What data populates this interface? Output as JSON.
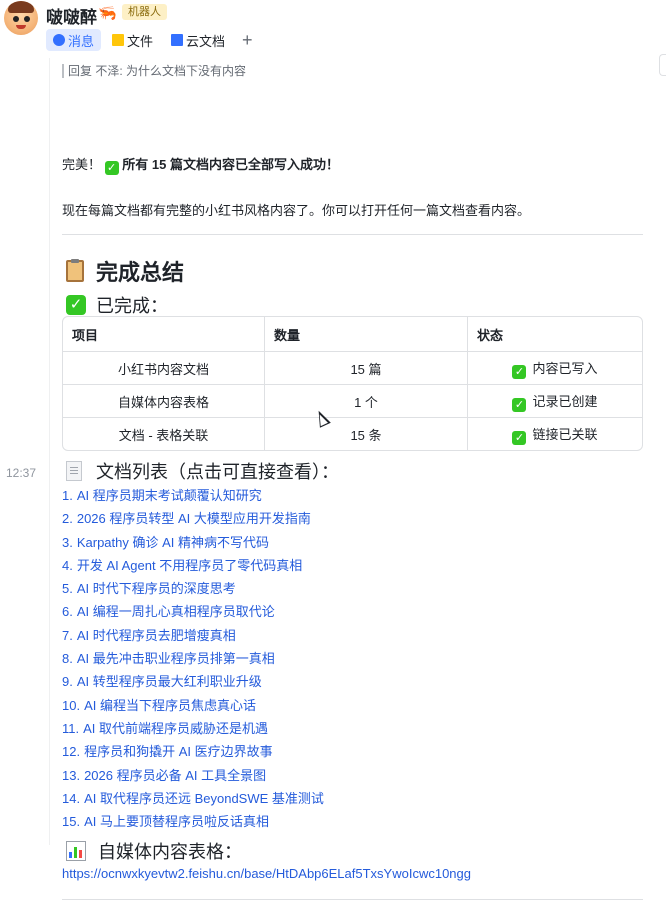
{
  "header": {
    "name": "啵啵醉",
    "name_emoji": "🦐",
    "badge": "机器人",
    "tabs": [
      {
        "label": "消息",
        "icon": "message-icon",
        "active": true
      },
      {
        "label": "文件",
        "icon": "folder-icon",
        "active": false
      },
      {
        "label": "云文档",
        "icon": "cloud-doc-icon",
        "active": false
      }
    ],
    "add_tab": "+"
  },
  "timestamp": "12:37",
  "message": {
    "reply_prefix": "回复",
    "reply_author": "不泽:",
    "reply_text": "为什么文档下没有内容",
    "line1_prefix": "完美！",
    "line1_bold": "所有 15 篇文档内容已全部写入成功！",
    "line2": "现在每篇文档都有完整的小红书风格内容了。你可以打开任何一篇文档查看内容。",
    "summary_heading": "完成总结",
    "done_heading": "已完成：",
    "table": {
      "headers": [
        "项目",
        "数量",
        "状态"
      ],
      "rows": [
        [
          "小红书内容文档",
          "15 篇",
          "内容已写入"
        ],
        [
          "自媒体内容表格",
          "1 个",
          "记录已创建"
        ],
        [
          "文档 - 表格关联",
          "15 条",
          "链接已关联"
        ]
      ]
    },
    "docs_heading": "文档列表（点击可直接查看）：",
    "docs": [
      "AI 程序员期末考试颠覆认知研究",
      "2026 程序员转型 AI 大模型应用开发指南",
      "Karpathy 确诊 AI 精神病不写代码",
      "开发 AI Agent 不用程序员了零代码真相",
      "AI 时代下程序员的深度思考",
      "AI 编程一周扎心真相程序员取代论",
      "AI 时代程序员去肥增瘦真相",
      "AI 最先冲击职业程序员排第一真相",
      "AI 转型程序员最大红利职业升级",
      "AI 编程当下程序员焦虑真心话",
      "AI 取代前端程序员威胁还是机遇",
      "程序员和狗撬开 AI 医疗边界故事",
      "2026 程序员必备 AI 工具全景图",
      "AI 取代程序员还远 BeyondSWE 基准测试",
      "AI 马上要顶替程序员啦反话真相"
    ],
    "table_heading": "自媒体内容表格：",
    "table_link": "https://ocnwxkyevtw2.feishu.cn/base/HtDAbp6ELaf5TxsYwoIcwc10ngg"
  }
}
